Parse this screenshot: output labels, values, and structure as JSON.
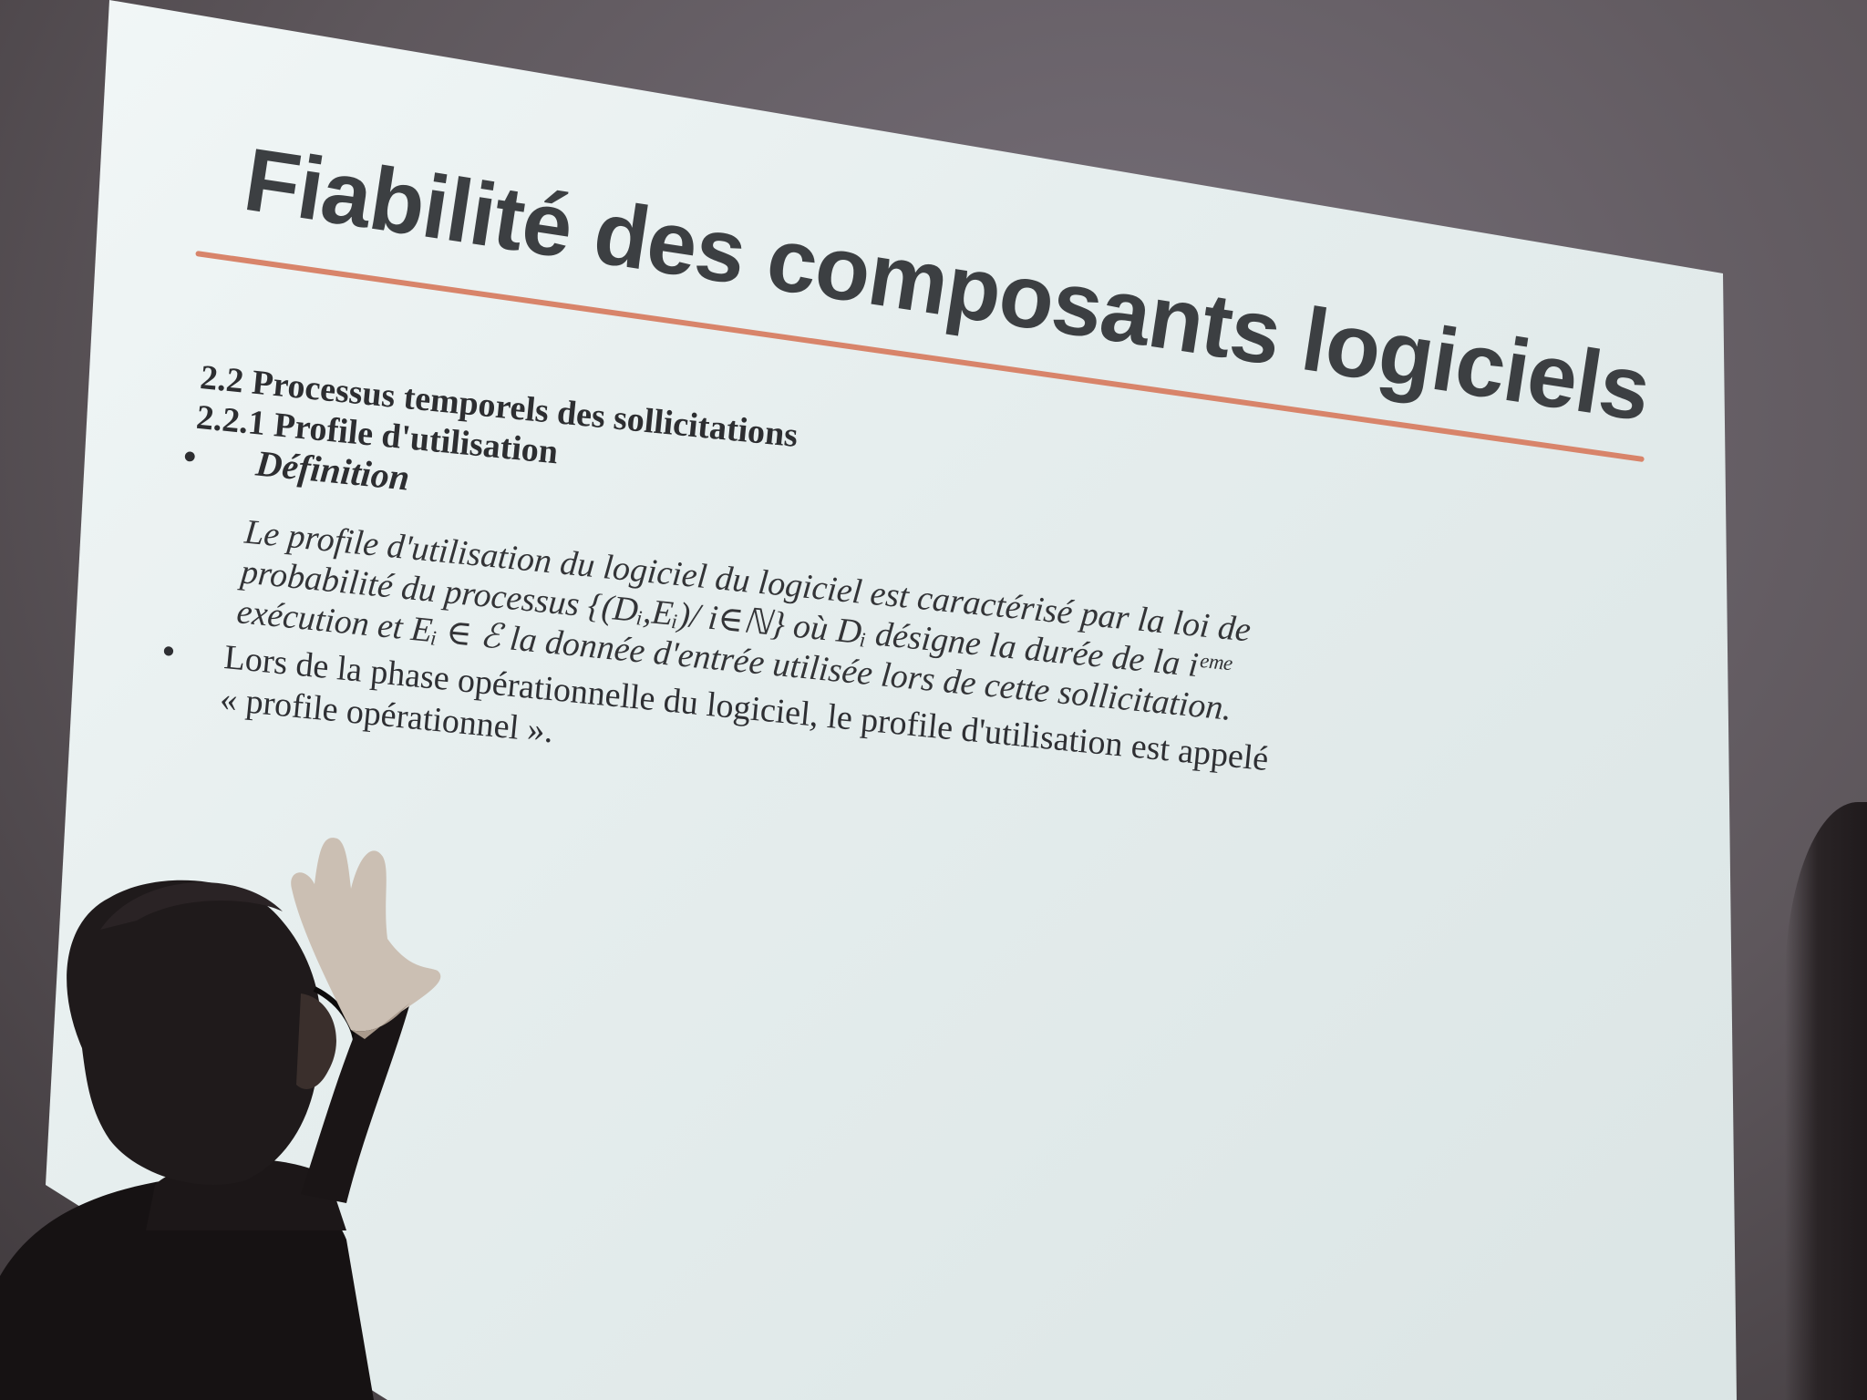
{
  "slide": {
    "title": "Fiabilité des composants logiciels",
    "section": "2.2 Processus temporels des sollicitations",
    "subsection": "2.2.1 Profile d'utilisation",
    "definition_label": "Définition",
    "definition_lines": [
      "Le profile d'utilisation du logiciel du logiciel est caractérisé par la loi de",
      "probabilité du processus {(Dᵢ,Eᵢ)/ i∈ℕ} où Dᵢ désigne la durée de la iᵉᵐᵉ",
      "exécution et Eᵢ ∈ ℰ la donnée d'entrée utilisée lors de cette sollicitation."
    ],
    "bullet2_lines": [
      "Lors de la phase opérationnelle du logiciel, le profile d'utilisation est appelé",
      "« profile opérationnel »."
    ],
    "bullet_symbol": "•"
  },
  "colors": {
    "screen": "#e6eeee",
    "title_text": "#3c3f42",
    "title_rule": "#d8846a",
    "body_text": "#2d2e31",
    "wall": "#5e575c",
    "silhouette": "#1c1718"
  }
}
